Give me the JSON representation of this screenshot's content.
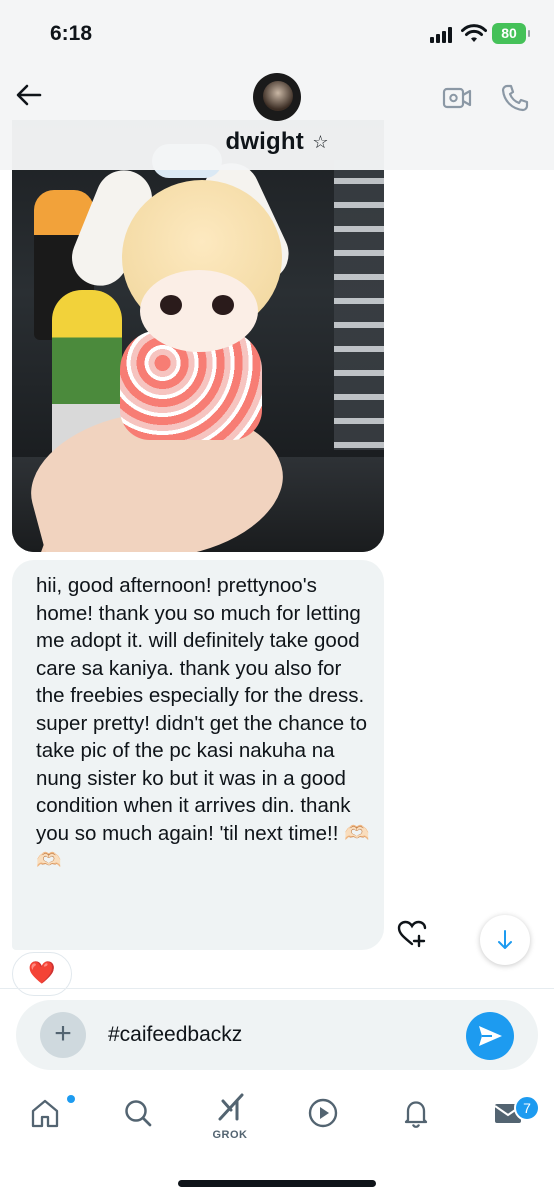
{
  "status_bar": {
    "time": "6:18",
    "battery": "80"
  },
  "header": {
    "contact_name": "dwight",
    "name_badge": "☆"
  },
  "messages": [
    {
      "type": "photo",
      "description_icon": "doll-photo"
    },
    {
      "type": "text",
      "text": "hii, good afternoon! prettynoo's home! thank you so much for letting me adopt it. will definitely take good care sa kaniya. thank you also for the freebies especially for the dress. super pretty! didn't get the chance to take pic of the pc kasi nakuha na nung sister ko but it was in a good condition when it arrives din. thank you so much again! 'til next time!! 🫶🏻🫶🏻"
    }
  ],
  "reaction": "❤️",
  "composer": {
    "value": "#caifeedbackz"
  },
  "tabbar": {
    "grok_label": "GROK",
    "messages_badge": "7"
  },
  "colors": {
    "accent": "#1d9bf0",
    "bubble": "#eff3f4",
    "battery": "#45c159"
  }
}
